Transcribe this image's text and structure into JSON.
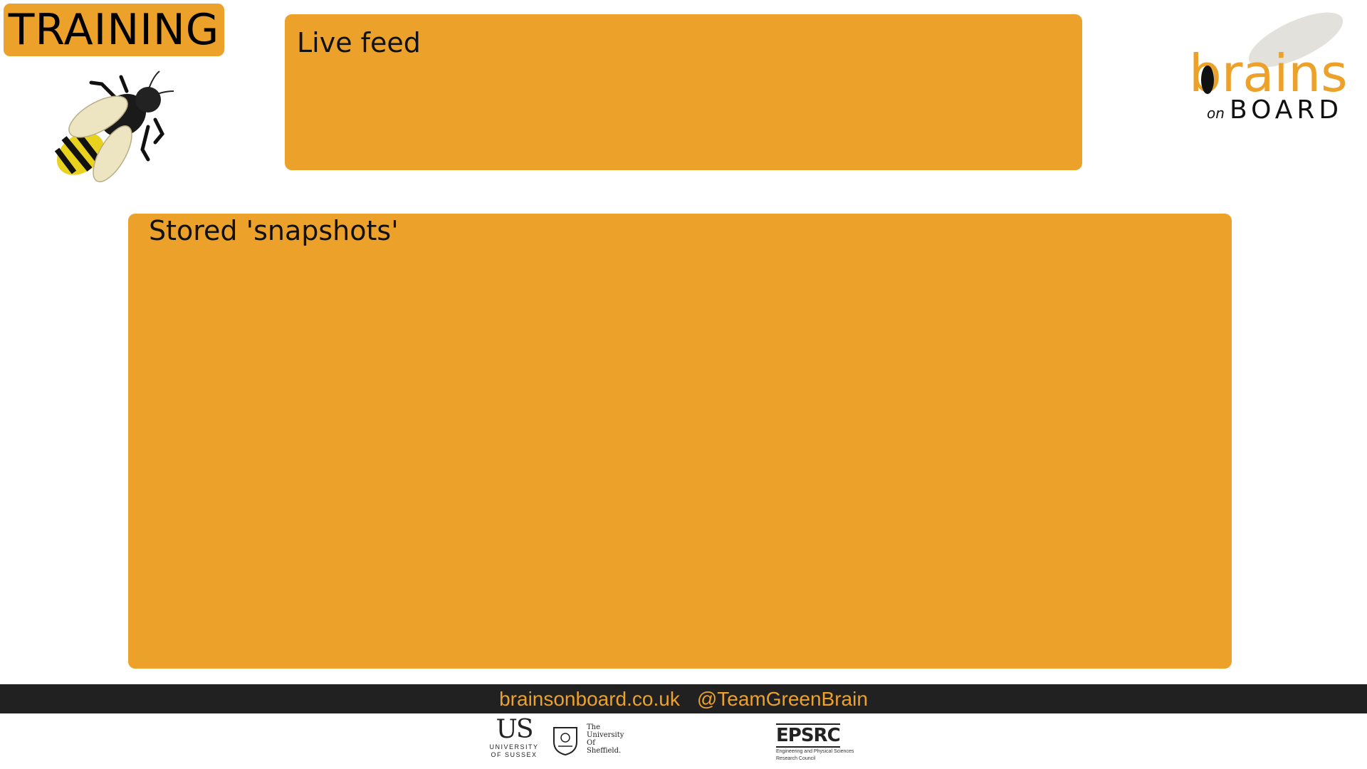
{
  "colors": {
    "accent": "#EBA12A",
    "footer_bg": "#222122"
  },
  "badge": {
    "label": "TRAINING"
  },
  "panels": {
    "live_feed": {
      "title": "Live feed"
    },
    "snapshots": {
      "title": "Stored 'snapshots'"
    }
  },
  "logo": {
    "word_top": "brains",
    "word_small": "on",
    "word_bottom": "BOARD"
  },
  "footer": {
    "website": "brainsonboard.co.uk",
    "handle": "@TeamGreenBrain"
  },
  "partners": {
    "sussex": {
      "big": "US",
      "line1": "UNIVERSITY",
      "line2": "OF SUSSEX"
    },
    "sheffield": {
      "line1": "The",
      "line2": "University",
      "line3": "Of",
      "line4": "Sheffield."
    },
    "epsrc": {
      "big": "EPSRC",
      "line1": "Engineering and Physical Sciences",
      "line2": "Research Council"
    }
  },
  "icons": [
    "bee-illustration",
    "brains-on-board-logo",
    "sheffield-crest-icon"
  ]
}
